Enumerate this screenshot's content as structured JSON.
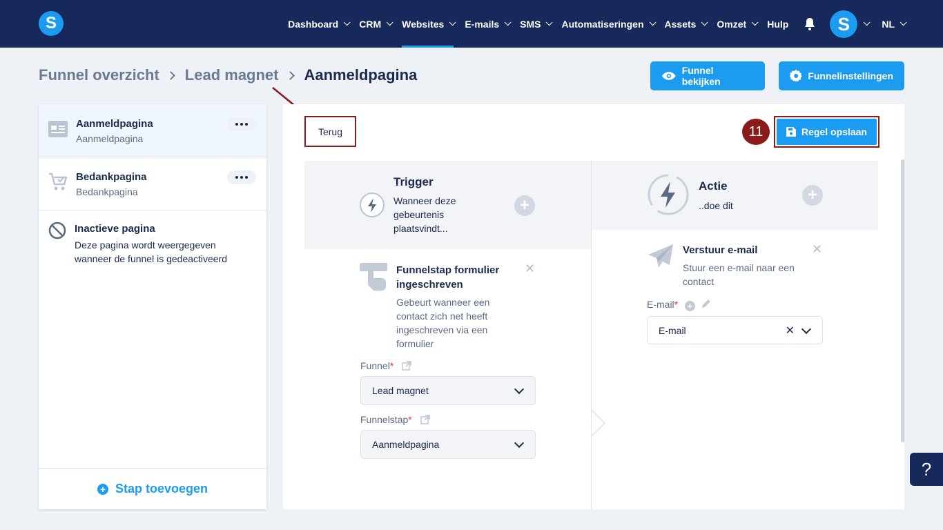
{
  "nav": {
    "items": [
      {
        "label": "Dashboard",
        "dropdown": true
      },
      {
        "label": "CRM",
        "dropdown": true
      },
      {
        "label": "Websites",
        "dropdown": true,
        "active": true
      },
      {
        "label": "E-mails",
        "dropdown": true
      },
      {
        "label": "SMS",
        "dropdown": true
      },
      {
        "label": "Automatiseringen",
        "dropdown": true
      },
      {
        "label": "Assets",
        "dropdown": true
      },
      {
        "label": "Omzet",
        "dropdown": true
      },
      {
        "label": "Hulp",
        "dropdown": false
      }
    ],
    "avatar_letter": "S",
    "language": "NL",
    "logo_letter": "S"
  },
  "breadcrumb": [
    "Funnel overzicht",
    "Lead magnet",
    "Aanmeldpagina"
  ],
  "header_buttons": {
    "view_funnel": "Funnel bekijken",
    "funnel_settings": "Funnelinstellingen"
  },
  "sidebar": {
    "steps": [
      {
        "title": "Aanmeldpagina",
        "subtitle": "Aanmeldpagina",
        "icon": "page-icon",
        "selected": true
      },
      {
        "title": "Bedankpagina",
        "subtitle": "Bedankpagina",
        "icon": "cart-check-icon",
        "selected": false
      }
    ],
    "inactive": {
      "title": "Inactieve pagina",
      "desc": "Deze pagina wordt weergegeven wanneer de funnel is gedeactiveerd"
    },
    "add_step": "Stap toevoegen"
  },
  "rule": {
    "back": "Terug",
    "save": "Regel opslaan",
    "badge": "11",
    "trigger": {
      "title": "Trigger",
      "desc": "Wanneer deze gebeurtenis plaatsvindt..."
    },
    "action": {
      "title": "Actie",
      "desc": "..doe dit"
    },
    "trigger_card": {
      "title": "Funnelstap formulier ingeschreven",
      "desc": "Gebeurt wanneer een contact zich net heeft ingeschreven via een formulier",
      "funnel_label": "Funnel",
      "funnel_value": "Lead magnet",
      "step_label": "Funnelstap",
      "step_value": "Aanmeldpagina"
    },
    "action_card": {
      "title": "Verstuur e-mail",
      "desc": "Stuur een e-mail naar een contact",
      "email_label": "E-mail",
      "email_value": "E-mail"
    }
  },
  "help": "?",
  "colors": {
    "nav_bg": "#17285b",
    "accent": "#1c9cf0",
    "annotation": "#8b1a1a"
  }
}
